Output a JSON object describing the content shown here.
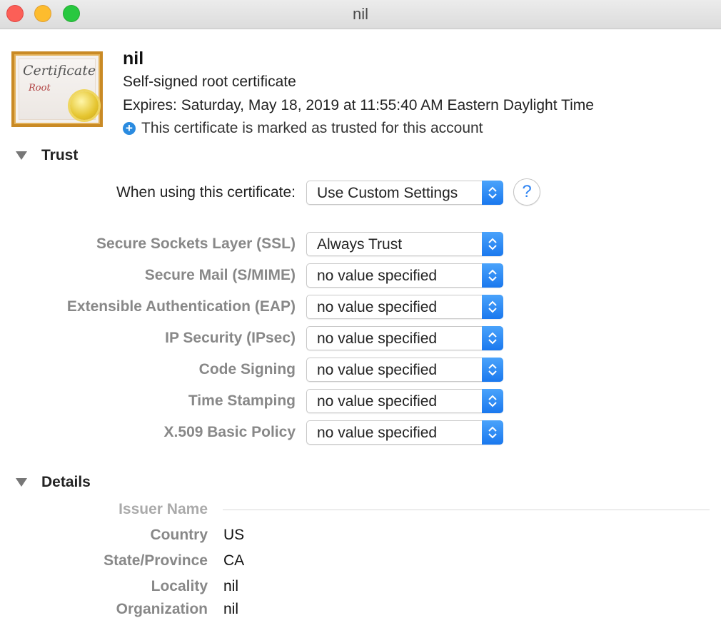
{
  "window": {
    "title": "nil"
  },
  "certificate": {
    "icon_title": "Certificate",
    "icon_subtitle": "Root",
    "name": "nil",
    "type": "Self-signed root certificate",
    "expires": "Expires: Saturday, May 18, 2019 at 11:55:40 AM Eastern Daylight Time",
    "trust_status": "This certificate is marked as trusted for this account"
  },
  "trust": {
    "section_title": "Trust",
    "when_using_label": "When using this certificate:",
    "when_using_value": "Use Custom Settings",
    "help_label": "?",
    "policies": [
      {
        "label": "Secure Sockets Layer (SSL)",
        "value": "Always Trust"
      },
      {
        "label": "Secure Mail (S/MIME)",
        "value": "no value specified"
      },
      {
        "label": "Extensible Authentication (EAP)",
        "value": "no value specified"
      },
      {
        "label": "IP Security (IPsec)",
        "value": "no value specified"
      },
      {
        "label": "Code Signing",
        "value": "no value specified"
      },
      {
        "label": "Time Stamping",
        "value": "no value specified"
      },
      {
        "label": "X.509 Basic Policy",
        "value": "no value specified"
      }
    ]
  },
  "details": {
    "section_title": "Details",
    "issuer_heading": "Issuer Name",
    "fields": [
      {
        "label": "Country",
        "value": "US"
      },
      {
        "label": "State/Province",
        "value": "CA"
      },
      {
        "label": "Locality",
        "value": "nil"
      },
      {
        "label": "Organization",
        "value": "nil"
      }
    ]
  },
  "colors": {
    "accent": "#2a8be0",
    "stepper": "#1a78ee"
  }
}
